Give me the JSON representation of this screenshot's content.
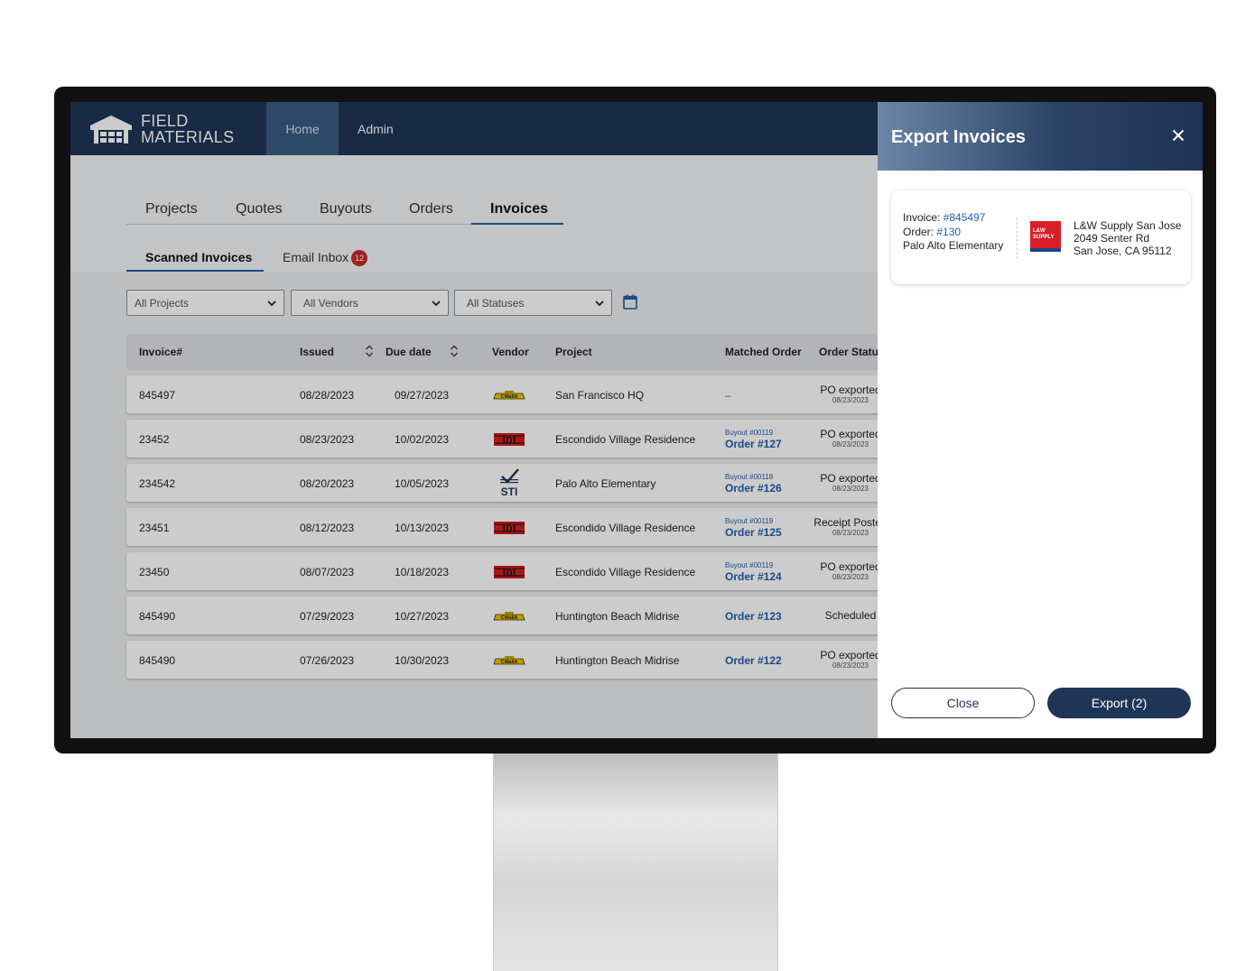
{
  "brand": {
    "line1": "FIELD",
    "line2": "MATERIALS"
  },
  "nav": {
    "home": "Home",
    "admin": "Admin"
  },
  "main_tabs": [
    "Projects",
    "Quotes",
    "Buyouts",
    "Orders",
    "Invoices"
  ],
  "sub_tabs": {
    "scanned": "Scanned Invoices",
    "email": "Email Inbox",
    "email_count": "12"
  },
  "filters": {
    "projects": "All Projects",
    "vendors": "All Vendors",
    "statuses": "All Statuses"
  },
  "columns": [
    "Invoice#",
    "Issued",
    "Due date",
    "Vendor",
    "Project",
    "Matched Order",
    "Order Status"
  ],
  "rows": [
    {
      "invoice": "845497",
      "issued": "08/28/2023",
      "due": "09/27/2023",
      "vendor": "cwalla-logo",
      "project": "San Francisco HQ",
      "buyout": "",
      "order": "–",
      "status": "PO exported",
      "status_date": "08/23/2023"
    },
    {
      "invoice": "23452",
      "issued": "08/23/2023",
      "due": "10/02/2023",
      "vendor": "idi-logo",
      "project": "Escondido Village Residence",
      "buyout": "Buyout #00119",
      "order": "Order #127",
      "status": "PO exported",
      "status_date": "08/23/2023"
    },
    {
      "invoice": "234542",
      "issued": "08/20/2023",
      "due": "10/05/2023",
      "vendor": "sti-logo",
      "project": "Palo Alto Elementary",
      "buyout": "Buyout #00118",
      "order": "Order #126",
      "status": "PO exported",
      "status_date": "08/23/2023"
    },
    {
      "invoice": "23451",
      "issued": "08/12/2023",
      "due": "10/13/2023",
      "vendor": "idi-logo",
      "project": "Escondido Village Residence",
      "buyout": "Buyout #00119",
      "order": "Order #125",
      "status": "Receipt Posted",
      "status_date": "08/23/2023"
    },
    {
      "invoice": "23450",
      "issued": "08/07/2023",
      "due": "10/18/2023",
      "vendor": "idi-logo",
      "project": "Escondido Village Residence",
      "buyout": "Buyout #00119",
      "order": "Order #124",
      "status": "PO exported",
      "status_date": "08/23/2023"
    },
    {
      "invoice": "845490",
      "issued": "07/29/2023",
      "due": "10/27/2023",
      "vendor": "cwalla-logo",
      "project": "Huntington Beach Midrise",
      "buyout": "",
      "order": "Order #123",
      "status": "Scheduled",
      "status_date": ""
    },
    {
      "invoice": "845490",
      "issued": "07/26/2023",
      "due": "10/30/2023",
      "vendor": "cwalla-logo",
      "project": "Huntington Beach Midrise",
      "buyout": "",
      "order": "Order #122",
      "status": "PO exported",
      "status_date": "08/23/2023"
    }
  ],
  "panel": {
    "title": "Export Invoices",
    "invoice_label": "Invoice: ",
    "invoice_link": "#845497",
    "order_label": "Order: ",
    "order_link": "#130",
    "project": "Palo Alto Elementary",
    "vendor_name": "L&W Supply San Jose",
    "vendor_addr1": "2049 Senter Rd",
    "vendor_addr2": "San Jose, CA 95112",
    "vendor_logo_text": "L&W SUPPLY",
    "close_label": "Close",
    "export_label": "Export (2)"
  },
  "colors": {
    "navy": "#1f3556",
    "accent_blue": "#1f5fa8",
    "badge_red": "#c42b2b"
  }
}
